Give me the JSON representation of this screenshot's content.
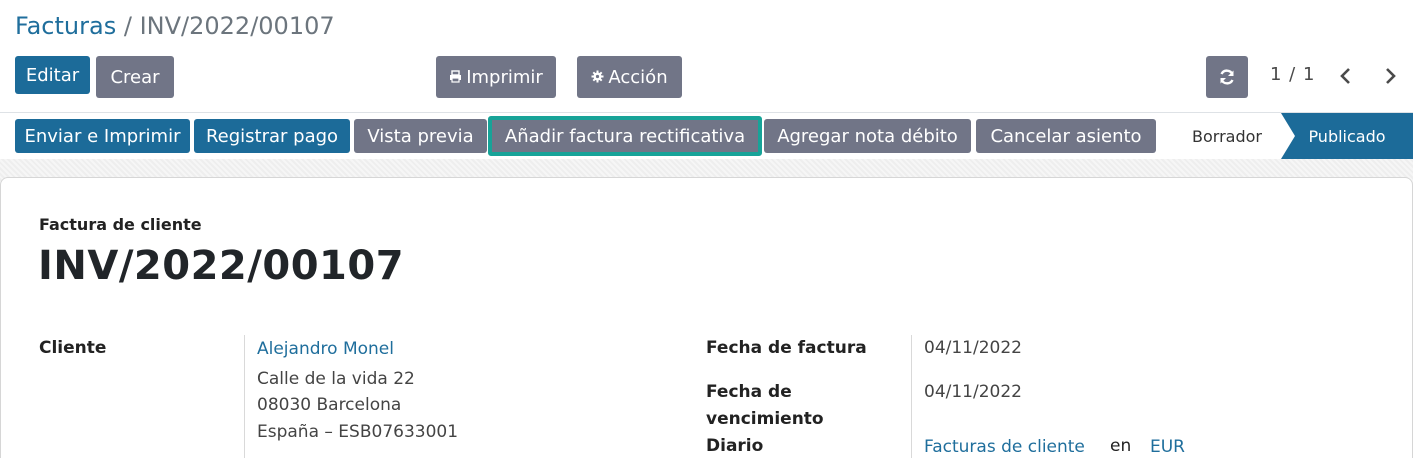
{
  "breadcrumb": {
    "parent": "Facturas",
    "separator": "/",
    "current": "INV/2022/00107"
  },
  "toolbar": {
    "edit_label": "Editar",
    "create_label": "Crear",
    "print_label": "Imprimir",
    "action_label": "Acción",
    "print_icon": "printer-icon",
    "action_icon": "gear-icon",
    "refresh_icon": "refresh-icon"
  },
  "pager": {
    "value": "1 / 1",
    "prev_icon": "chevron-left-icon",
    "next_icon": "chevron-right-icon"
  },
  "status_buttons": [
    {
      "label": "Enviar e Imprimir"
    },
    {
      "label": "Registrar pago"
    },
    {
      "label": "Vista previa"
    },
    {
      "label": "Añadir factura rectificativa"
    },
    {
      "label": "Agregar nota débito"
    },
    {
      "label": "Cancelar asiento"
    }
  ],
  "states": {
    "draft": "Borrador",
    "posted": "Publicado",
    "current": "Publicado"
  },
  "document": {
    "type": "Factura de cliente",
    "name": "INV/2022/00107",
    "customer_label": "Cliente",
    "customer_name": "Alejandro Monel",
    "address_line1": "Calle de la vida 22",
    "address_line2": "08030 Barcelona",
    "address_line3": "España – ESB07633001",
    "invoice_date_label": "Fecha de factura",
    "invoice_date": "04/11/2022",
    "due_date_label_1": "Fecha de",
    "due_date_label_2": "vencimiento",
    "due_date": "04/11/2022",
    "journal_label": "Diario",
    "journal": "Facturas de cliente",
    "journal_in": "en",
    "currency": "EUR"
  },
  "colors": {
    "primary": "#1c6b99",
    "secondary": "#717587",
    "focus": "#17a398",
    "link": "#1f6e9c"
  }
}
